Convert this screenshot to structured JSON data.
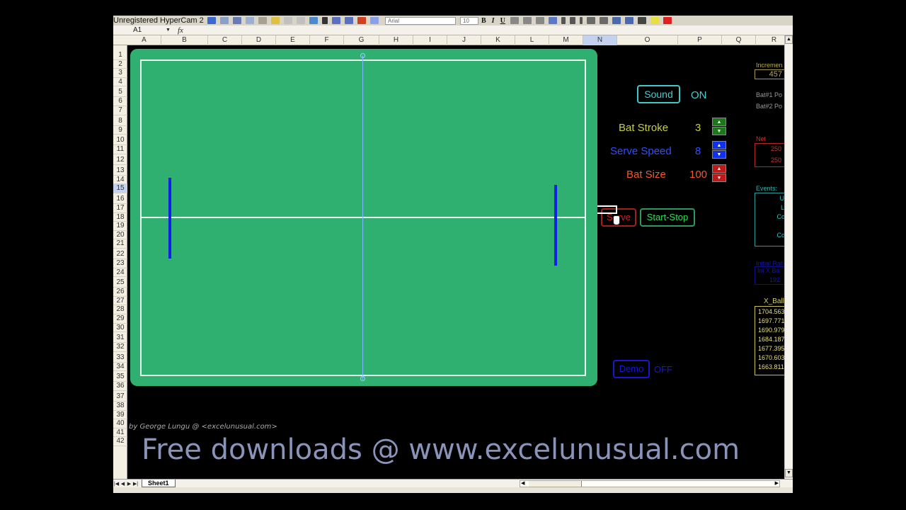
{
  "window": {
    "title": "Unregistered HyperCam 2",
    "font_name": "Arial",
    "font_size": "10",
    "format_buttons": [
      "B",
      "I",
      "U"
    ]
  },
  "formula_bar": {
    "name_box": "A1",
    "fx_label": "fx",
    "formula": ""
  },
  "columns": [
    "A",
    "B",
    "C",
    "D",
    "E",
    "F",
    "G",
    "H",
    "I",
    "J",
    "K",
    "L",
    "M",
    "N",
    "O",
    "P",
    "Q",
    "R"
  ],
  "active_column": "N",
  "rows": [
    "1",
    "2",
    "3",
    "4",
    "5",
    "6",
    "7",
    "8",
    "9",
    "10",
    "11",
    "12",
    "13",
    "14",
    "15",
    "16",
    "17",
    "18",
    "19",
    "20",
    "21",
    "22",
    "23",
    "24",
    "25",
    "26",
    "27",
    "28",
    "29",
    "30",
    "31",
    "32",
    "33",
    "34",
    "35",
    "36",
    "37",
    "38",
    "39",
    "40",
    "41",
    "42"
  ],
  "active_row": "15",
  "game": {
    "court_color": "#2fb070",
    "line_color": "#e8f6ee",
    "bat_color": "#1020e8",
    "net_color": "#7ab8ff"
  },
  "controls": {
    "sound": {
      "label": "Sound",
      "state": "ON",
      "color": "#40d0d0"
    },
    "bat_stroke": {
      "label": "Bat Stroke",
      "value": "3",
      "color": "#c8d040",
      "spin_color": "#1a7a1a"
    },
    "serve_speed": {
      "label": "Serve Speed",
      "value": "8",
      "color": "#3050ff",
      "spin_color": "#1030f0"
    },
    "bat_size": {
      "label": "Bat Size",
      "value": "100",
      "color": "#f05a28",
      "spin_color": "#c01818"
    },
    "serve": {
      "label": "Serve",
      "color": "#d02020"
    },
    "start_stop": {
      "label": "Start-Stop",
      "color": "#30e050"
    },
    "demo": {
      "label": "Demo",
      "state": "OFF",
      "color": "#1818d8"
    },
    "spin_up": "▲",
    "spin_down": "▼"
  },
  "side_panel": {
    "increment_label": "Incremen",
    "increment_value": "457",
    "bat1_label": "Bat#1 Po",
    "bat2_label": "Bat#2 Po",
    "net_label": "Net",
    "net_values": [
      "250",
      "250"
    ],
    "events_label": "Events:",
    "events": [
      "Up",
      "Lo",
      "Coll",
      "",
      "Coll"
    ],
    "initial_label": "Initial Rat",
    "initial_header": "Ini X Ba",
    "initial_value": "192",
    "xball_label": "X_Ball",
    "xball_values": [
      "1704.563",
      "1697.771",
      "1690.979",
      "1684.187",
      "1677.395",
      "1670.603",
      "1663.811"
    ]
  },
  "credits": {
    "byline": "by George Lungu @ <excelunusual.com>",
    "banner": "Free downloads @ www.excelunusual.com"
  },
  "sheet_tabs": [
    "Sheet1"
  ],
  "nav_buttons": [
    "|◀",
    "◀",
    "▶",
    "▶|"
  ]
}
